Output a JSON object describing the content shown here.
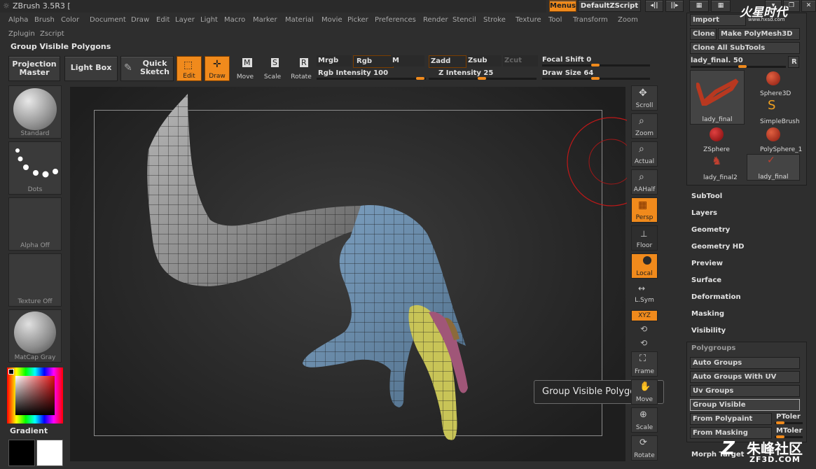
{
  "app_title": "ZBrush 3.5R3 [",
  "menus": [
    "Alpha",
    "Brush",
    "Color",
    "Document",
    "Draw",
    "Edit",
    "Layer",
    "Light",
    "Macro",
    "Marker",
    "Material",
    "Movie",
    "Picker",
    "Preferences",
    "Render",
    "Stencil",
    "Stroke",
    "Texture",
    "Tool",
    "Transform",
    "Zoom"
  ],
  "menus2": [
    "Zplugin",
    "Zscript"
  ],
  "menus_button": "Menus",
  "default_zscript": "DefaultZScript",
  "tool_title": "Group Visible Polygons",
  "top_shelf": {
    "projection_master": "Projection Master",
    "light_box": "Light Box",
    "quick_sketch": "Quick Sketch",
    "edit": "Edit",
    "draw": "Draw",
    "move": "Move",
    "scale": "Scale",
    "rotate": "Rotate",
    "mrgb": "Mrgb",
    "rgb": "Rgb",
    "m": "M",
    "zadd": "Zadd",
    "zsub": "Zsub",
    "zcut": "Zcut",
    "rgb_intensity": "Rgb Intensity 100",
    "z_intensity": "Z Intensity 25",
    "focal_shift": "Focal Shift 0",
    "draw_size": "Draw Size 64"
  },
  "left_shelf": {
    "standard": "Standard",
    "dots": "Dots",
    "alpha": "Alpha Off",
    "texture": "Texture Off",
    "matcap": "MatCap Gray",
    "gradient": "Gradient"
  },
  "right_shelf": [
    "Scroll",
    "Zoom",
    "Actual",
    "AAHalf",
    "Persp",
    "Floor",
    "Local",
    "L.Sym",
    "XYZ",
    "Frame",
    "Move",
    "Scale",
    "Rotate"
  ],
  "tooltip": "Group Visible Polygons",
  "tool_palette": {
    "import": "Import",
    "clone": "Clone",
    "make_polymesh": "Make PolyMesh3D",
    "clone_all": "Clone All SubTools",
    "current_tool": "lady_final. 50",
    "r": "R",
    "subtools": [
      "lady_final",
      "Sphere3D",
      "SimpleBrush",
      "ZSphere",
      "PolySphere_1",
      "lady_final2",
      "lady_final"
    ],
    "sections": [
      "SubTool",
      "Layers",
      "Geometry",
      "Geometry HD",
      "Preview",
      "Surface",
      "Deformation",
      "Masking",
      "Visibility"
    ],
    "polygroups": "Polygroups",
    "pg_buttons": [
      "Auto Groups",
      "Auto Groups With UV",
      "Uv Groups",
      "Group Visible",
      "From Polypaint",
      "From Masking"
    ],
    "ptoler": "PToler",
    "mtoler": "MToler",
    "morph_target": "Morph Target"
  },
  "watermark_top": "火星时代",
  "watermark_top_url": "www.hxsd.com",
  "watermark_bottom": "朱峰社区",
  "watermark_bottom_url": "ZF3D.COM",
  "colors": {
    "accent": "#f08a1c",
    "bg": "#2e2e2e",
    "canvas": "#2a2a2a"
  }
}
